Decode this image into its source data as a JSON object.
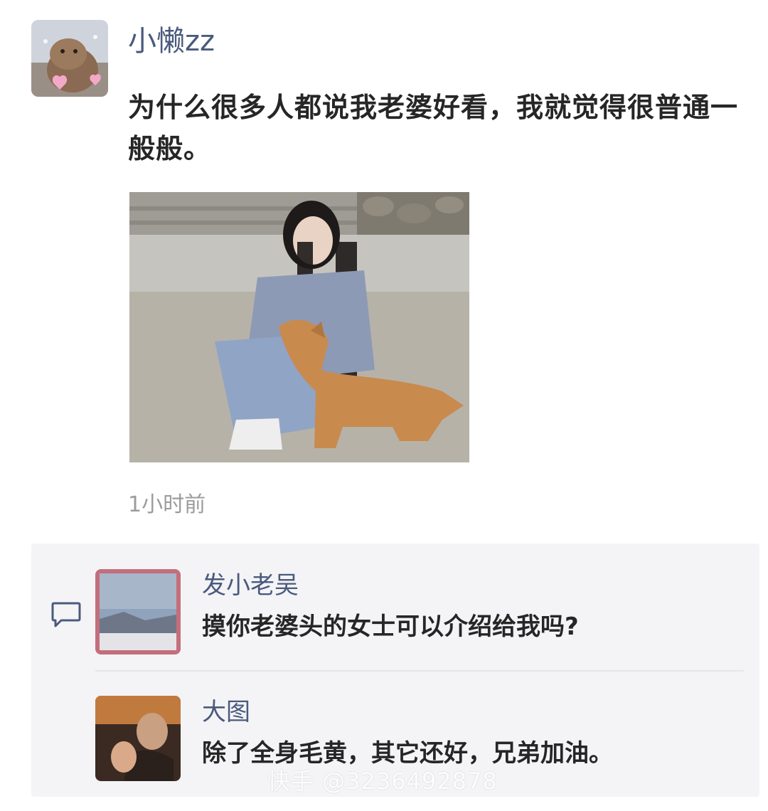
{
  "post": {
    "username": "小懒zz",
    "text": "为什么很多人都说我老婆好看，我就觉得很普通一般般。",
    "timestamp": "1小时前"
  },
  "comments": [
    {
      "author": "发小老吴",
      "text": "摸你老婆头的女士可以介绍给我吗?"
    },
    {
      "author": "大图",
      "text": "除了全身毛黄，其它还好，兄弟加油。"
    }
  ],
  "watermark": "快手 @3236492878",
  "icons": {
    "comment": "comment-bubble-icon"
  },
  "colors": {
    "name": "#4a5a7e",
    "panel": "#f4f4f6",
    "timestamp": "#9c9c9c"
  }
}
